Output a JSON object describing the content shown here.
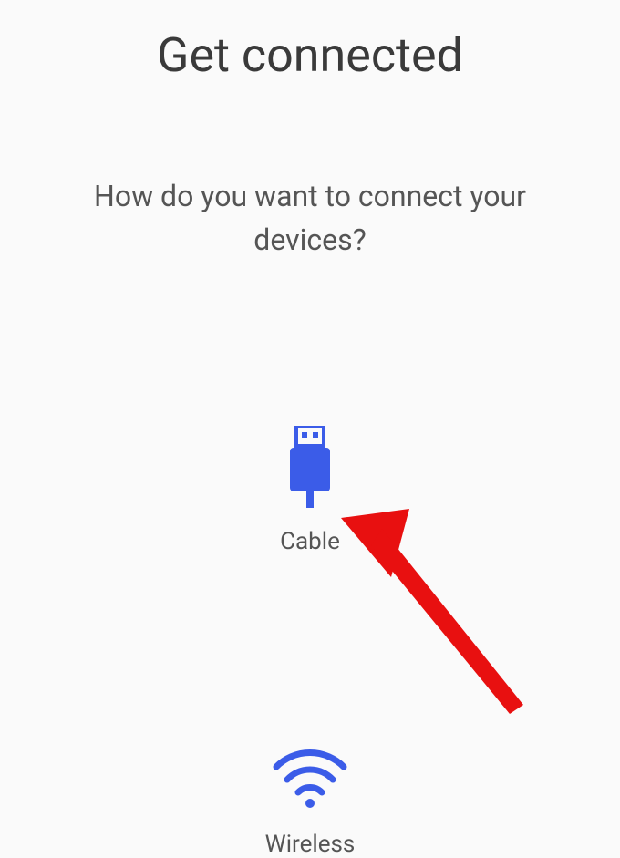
{
  "title": "Get connected",
  "subtitle": "How do you want to connect your devices?",
  "options": {
    "cable": {
      "label": "Cable",
      "icon": "usb-cable-icon"
    },
    "wireless": {
      "label": "Wireless",
      "icon": "wifi-icon"
    }
  },
  "colors": {
    "accent": "#3b5ce8",
    "annotation": "#e81010"
  }
}
